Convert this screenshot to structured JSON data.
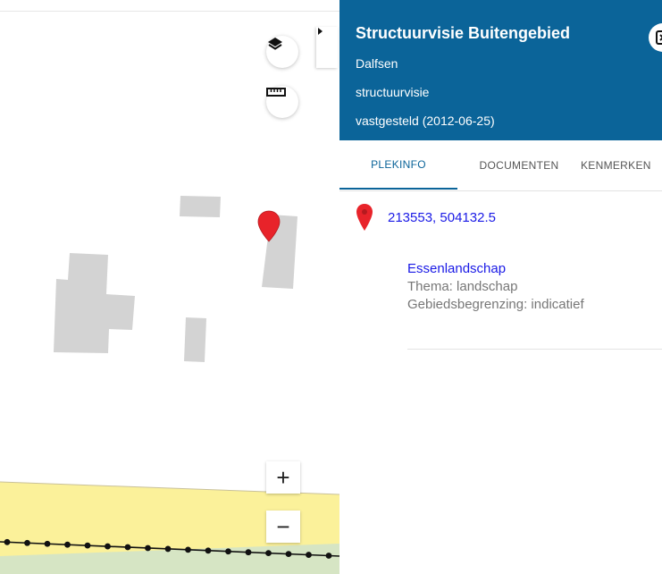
{
  "map": {
    "layers_icon": "layers-icon",
    "measure_icon": "ruler-icon",
    "collapse_icon": "caret-right-icon",
    "marker_icon": "map-marker-icon",
    "zoom_in_label": "+",
    "zoom_out_label": "−",
    "colors": {
      "building": "#d3d3d3",
      "zone_yellow": "#fbf19a",
      "zone_green": "#d6e5c4",
      "marker": "#e8232a",
      "boundary_line": "#111111"
    }
  },
  "panel": {
    "title": "Structuurvisie Buitengebied",
    "municipality": "Dalfsen",
    "plan_type": "structuurvisie",
    "status": "vastgesteld (2012-06-25)",
    "close_icon": "close-icon",
    "header_color": "#0b6499",
    "tabs": [
      {
        "label": "PLEKINFO",
        "active": true
      },
      {
        "label": "DOCUMENTEN",
        "active": false
      },
      {
        "label": "KENMERKEN",
        "active": false
      }
    ],
    "location": {
      "coordinates": "213553, 504132.5",
      "marker_icon": "map-marker-icon"
    },
    "feature": {
      "name": "Essenlandschap",
      "thema": "Thema: landschap",
      "begrenzing": "Gebiedsbegrenzing: indicatief"
    }
  }
}
